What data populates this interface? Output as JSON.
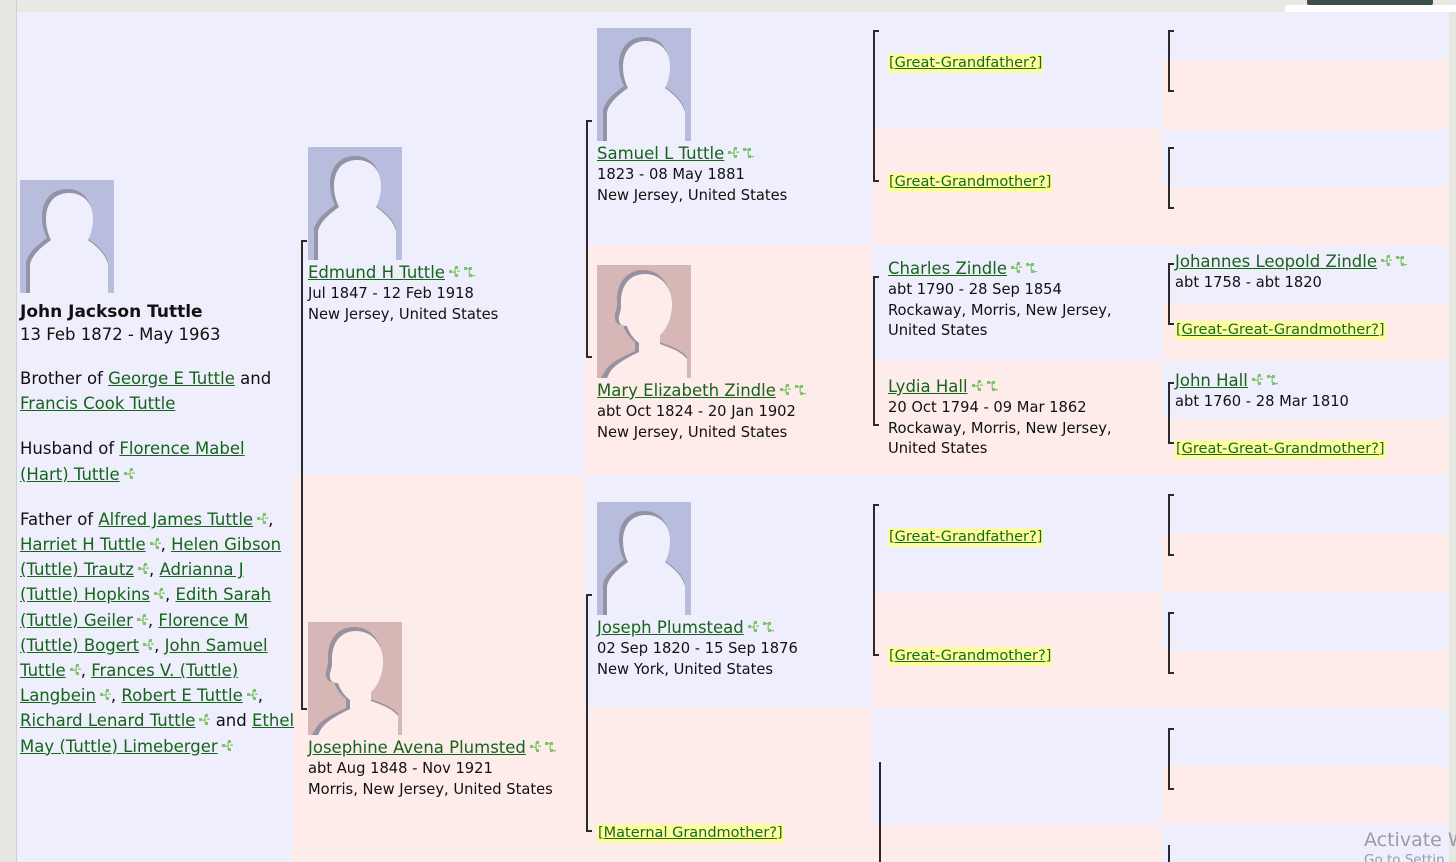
{
  "focus": {
    "name": "John Jackson Tuttle",
    "dates": "13 Feb 1872 - May 1963",
    "avatar": "male-silhouette-avatar",
    "sibling_prefix": "Brother of ",
    "sibling_1": "George E Tuttle",
    "sibling_joiner": " and ",
    "sibling_2": "Francis Cook Tuttle",
    "spouse_prefix": "Husband of ",
    "spouse_1": "Florence Mabel (Hart) Tuttle",
    "children_prefix": "Father of ",
    "children": [
      "Alfred James Tuttle",
      "Harriet H Tuttle",
      "Helen Gibson (Tuttle) Trautz",
      "Adrianna J (Tuttle) Hopkins",
      "Edith Sarah (Tuttle) Geiler",
      "Florence M (Tuttle) Bogert",
      "John Samuel Tuttle",
      "Frances V. (Tuttle) Langbein",
      "Robert E Tuttle",
      "Richard Lenard Tuttle",
      "Ethel May (Tuttle) Limeberger"
    ],
    "children_last_joiner": " and "
  },
  "parents": {
    "father": {
      "name": "Edmund H Tuttle",
      "dates": "Jul 1847 - 12 Feb 1918",
      "place": "New Jersey, United States",
      "avatar": "male-silhouette-avatar"
    },
    "mother": {
      "name": "Josephine Avena Plumsted",
      "dates": "abt Aug 1848 - Nov 1921",
      "place": "Morris, New Jersey, United States",
      "avatar": "female-silhouette-avatar"
    }
  },
  "grandparents": {
    "paternal_grandfather": {
      "name": "Samuel L Tuttle",
      "dates": "1823 - 08 May 1881",
      "place": "New Jersey, United States",
      "avatar": "male-silhouette-avatar"
    },
    "paternal_grandmother": {
      "name": "Mary Elizabeth Zindle",
      "dates": "abt Oct 1824 - 20 Jan 1902",
      "place": "New Jersey, United States",
      "avatar": "female-silhouette-avatar"
    },
    "maternal_grandfather": {
      "name": "Joseph Plumstead",
      "dates": "02 Sep 1820 - 15 Sep 1876",
      "place": "New York, United States",
      "avatar": "male-silhouette-avatar"
    },
    "maternal_grandmother_placeholder": "[Maternal Grandmother?]"
  },
  "great_grandparents": {
    "p1_father_placeholder": "[Great-Grandfather?]",
    "p1_mother_placeholder": "[Great-Grandmother?]",
    "p2_father": {
      "name": "Charles Zindle",
      "dates": "abt 1790 - 28 Sep 1854",
      "place": "Rockaway, Morris, New Jersey, United States"
    },
    "p2_mother": {
      "name": "Lydia Hall",
      "dates": "20 Oct 1794 - 09 Mar 1862",
      "place": "Rockaway, Morris, New Jersey, United States"
    },
    "m1_father_placeholder": "[Great-Grandfather?]",
    "m1_mother_placeholder": "[Great-Grandmother?]"
  },
  "great_great_grandparents": {
    "gg1": {
      "name": "Johannes Leopold Zindle",
      "dates": "abt 1758 - abt 1820"
    },
    "gg1_mother_placeholder": "[Great-Great-Grandmother?]",
    "gg2": {
      "name": "John Hall",
      "dates": "abt 1760 - 28 Mar 1810"
    },
    "gg2_mother_placeholder": "[Great-Great-Grandmother?]"
  },
  "watermark": {
    "line1": "Activate W",
    "line2": "Go to Settin"
  },
  "colors": {
    "male_band": "#eeeefc",
    "female_band": "#fdecea",
    "link_green": "#16641c",
    "placeholder_highlight": "#fdfda0",
    "connector": "#2a2a2a",
    "male_avatar": "#b8bcdd",
    "female_avatar": "#d7b6b6"
  },
  "icons": {
    "tree_icon": "family-tree-icon",
    "tree_icon_alt": "family-tree-branch-icon"
  }
}
